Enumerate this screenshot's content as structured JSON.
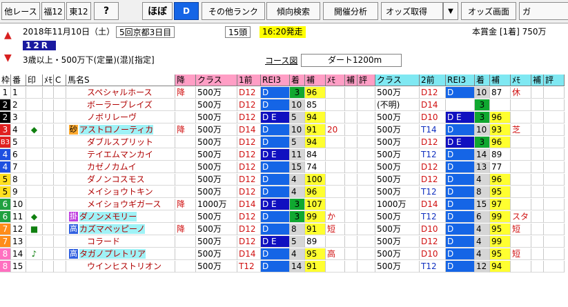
{
  "toolbar": {
    "buttons": [
      "他レース",
      "福12",
      "東12",
      "?",
      "ほぼ",
      "D",
      "その他ランク",
      "傾向検索",
      "開催分析",
      "オッズ取得",
      "▼",
      "オッズ画面",
      "ガ"
    ]
  },
  "race": {
    "date_line": "2018年11月10日（土）",
    "meeting": "5回京都3日目",
    "heads": "15頭",
    "start": "16:20発走",
    "prize": "本賞金 [1着] 750万",
    "race_no": "12R",
    "conditions": "3歳以上・500万下(定量)(混)[指定]",
    "course_label": "コース図",
    "course": "ダート1200m"
  },
  "header": [
    "枠",
    "番",
    "印",
    "ﾒﾓ",
    "C",
    "馬名S",
    "降",
    "クラス",
    "1前",
    "REI3",
    "着",
    "補",
    "ﾒﾓ",
    "補",
    "評",
    "クラス",
    "2前",
    "REI3",
    "着",
    "補",
    "ﾒﾓ",
    "補",
    "評"
  ],
  "rows": [
    {
      "waku": "1",
      "ban": "1",
      "mark": "",
      "c": "",
      "kun": "",
      "name": "スペシャルホース",
      "fall": "降",
      "cls1": "500万",
      "d1": "D12",
      "r1": "D",
      "rank1": "3",
      "ho1": "96",
      "memo1": "",
      "cls2": "500万",
      "d2": "D12",
      "r2": "D",
      "rank2": "10",
      "ho2": "87",
      "memo2": "休"
    },
    {
      "waku": "2",
      "ban": "2",
      "mark": "",
      "c": "",
      "kun": "",
      "name": "ボーラーブレイズ",
      "fall": "",
      "cls1": "500万",
      "d1": "D12",
      "r1": "D",
      "rank1": "10",
      "ho1": "85",
      "memo1": "",
      "cls2": "(不明)",
      "d2": "D14",
      "r2": "",
      "rank2": "3",
      "ho2": "",
      "memo2": ""
    },
    {
      "waku": "2",
      "ban": "3",
      "mark": "",
      "c": "",
      "kun": "",
      "name": "ノボリレーヴ",
      "fall": "",
      "cls1": "500万",
      "d1": "D12",
      "r1": "DE",
      "rank1": "5",
      "ho1": "94",
      "memo1": "",
      "cls2": "500万",
      "d2": "D10",
      "r2": "DE",
      "rank2": "3",
      "ho2": "96",
      "memo2": ""
    },
    {
      "waku": "3",
      "ban": "4",
      "mark": "◆",
      "c": "",
      "kun": "砂",
      "name": "アストロノーティカ",
      "fall": "降",
      "cls1": "500万",
      "d1": "D14",
      "r1": "D",
      "rank1": "10",
      "ho1": "91",
      "memo1": "20",
      "cls2": "500万",
      "d2": "T14",
      "r2": "D",
      "rank2": "10",
      "ho2": "93",
      "memo2": "芝"
    },
    {
      "waku": "B3",
      "ban": "5",
      "mark": "",
      "c": "",
      "kun": "",
      "name": "ダブルスプリット",
      "fall": "",
      "cls1": "500万",
      "d1": "D12",
      "r1": "D",
      "rank1": "5",
      "ho1": "94",
      "memo1": "",
      "cls2": "500万",
      "d2": "D12",
      "r2": "DE",
      "rank2": "3",
      "ho2": "96",
      "memo2": ""
    },
    {
      "waku": "4",
      "ban": "6",
      "mark": "",
      "c": "",
      "kun": "",
      "name": "テイエムマンカイ",
      "fall": "",
      "cls1": "500万",
      "d1": "D12",
      "r1": "DE",
      "rank1": "11",
      "ho1": "84",
      "memo1": "",
      "cls2": "500万",
      "d2": "T12",
      "r2": "D",
      "rank2": "14",
      "ho2": "89",
      "memo2": ""
    },
    {
      "waku": "4",
      "ban": "7",
      "mark": "",
      "c": "",
      "kun": "",
      "name": "カゼノカムイ",
      "fall": "",
      "cls1": "500万",
      "d1": "D12",
      "r1": "D",
      "rank1": "15",
      "ho1": "74",
      "memo1": "",
      "cls2": "500万",
      "d2": "D12",
      "r2": "D",
      "rank2": "13",
      "ho2": "77",
      "memo2": ""
    },
    {
      "waku": "5",
      "ban": "8",
      "mark": "",
      "c": "",
      "kun": "",
      "name": "ダノンコスモス",
      "fall": "",
      "cls1": "500万",
      "d1": "D12",
      "r1": "D",
      "rank1": "4",
      "ho1": "100",
      "memo1": "",
      "cls2": "500万",
      "d2": "D12",
      "r2": "D",
      "rank2": "4",
      "ho2": "96",
      "memo2": ""
    },
    {
      "waku": "5",
      "ban": "9",
      "mark": "",
      "c": "",
      "kun": "",
      "name": "メイショウトキン",
      "fall": "",
      "cls1": "500万",
      "d1": "D12",
      "r1": "D",
      "rank1": "4",
      "ho1": "96",
      "memo1": "",
      "cls2": "500万",
      "d2": "T12",
      "r2": "D",
      "rank2": "8",
      "ho2": "95",
      "memo2": ""
    },
    {
      "waku": "6",
      "ban": "10",
      "mark": "",
      "c": "",
      "kun": "",
      "name": "メイショウギガース",
      "fall": "降",
      "cls1": "1000万",
      "d1": "D14",
      "r1": "DE",
      "rank1": "3",
      "ho1": "107",
      "memo1": "",
      "cls2": "1000万",
      "d2": "D14",
      "r2": "D",
      "rank2": "15",
      "ho2": "97",
      "memo2": ""
    },
    {
      "waku": "6",
      "ban": "11",
      "mark": "◆",
      "c": "",
      "kun": "掛",
      "name": "ダノンメモリー",
      "fall": "",
      "cls1": "500万",
      "d1": "D12",
      "r1": "D",
      "rank1": "3",
      "ho1": "99",
      "memo1": "か",
      "cls2": "500万",
      "d2": "T12",
      "r2": "D",
      "rank2": "6",
      "ho2": "99",
      "memo2": "スタ"
    },
    {
      "waku": "7",
      "ban": "12",
      "mark": "■",
      "c": "",
      "kun": "高",
      "name": "カズマペッピーノ",
      "fall": "降",
      "cls1": "500万",
      "d1": "D12",
      "r1": "D",
      "rank1": "8",
      "ho1": "91",
      "memo1": "短",
      "cls2": "500万",
      "d2": "D10",
      "r2": "D",
      "rank2": "4",
      "ho2": "95",
      "memo2": "短"
    },
    {
      "waku": "7",
      "ban": "13",
      "mark": "",
      "c": "",
      "kun": "",
      "name": "コラード",
      "fall": "",
      "cls1": "500万",
      "d1": "D12",
      "r1": "DE",
      "rank1": "5",
      "ho1": "89",
      "memo1": "",
      "cls2": "500万",
      "d2": "D12",
      "r2": "D",
      "rank2": "4",
      "ho2": "99",
      "memo2": ""
    },
    {
      "waku": "8",
      "ban": "14",
      "mark": "♪",
      "c": "",
      "kun": "高",
      "name": "タガノプレトリア",
      "fall": "",
      "cls1": "500万",
      "d1": "D14",
      "r1": "D",
      "rank1": "4",
      "ho1": "95",
      "memo1": "高",
      "cls2": "500万",
      "d2": "D10",
      "r2": "D",
      "rank2": "4",
      "ho2": "95",
      "memo2": "短"
    },
    {
      "waku": "8",
      "ban": "15",
      "mark": "",
      "c": "",
      "kun": "",
      "name": "ウインヒストリオン",
      "fall": "",
      "cls1": "500万",
      "d1": "T12",
      "r1": "D",
      "rank1": "14",
      "ho1": "91",
      "memo1": "",
      "cls2": "500万",
      "d2": "T12",
      "r2": "D",
      "rank2": "12",
      "ho2": "94",
      "memo2": ""
    }
  ],
  "colors": {
    "waku": {
      "1": "#ffffff",
      "2": "#000000",
      "3": "#e02020",
      "B3": "#e02020",
      "4": "#1e50e0",
      "5": "#ffe020",
      "6": "#20a040",
      "7": "#ff8c1a",
      "8": "#ff70c0"
    },
    "header_pink": "#ff9ec5",
    "header_cyan": "#7fe8f2"
  }
}
